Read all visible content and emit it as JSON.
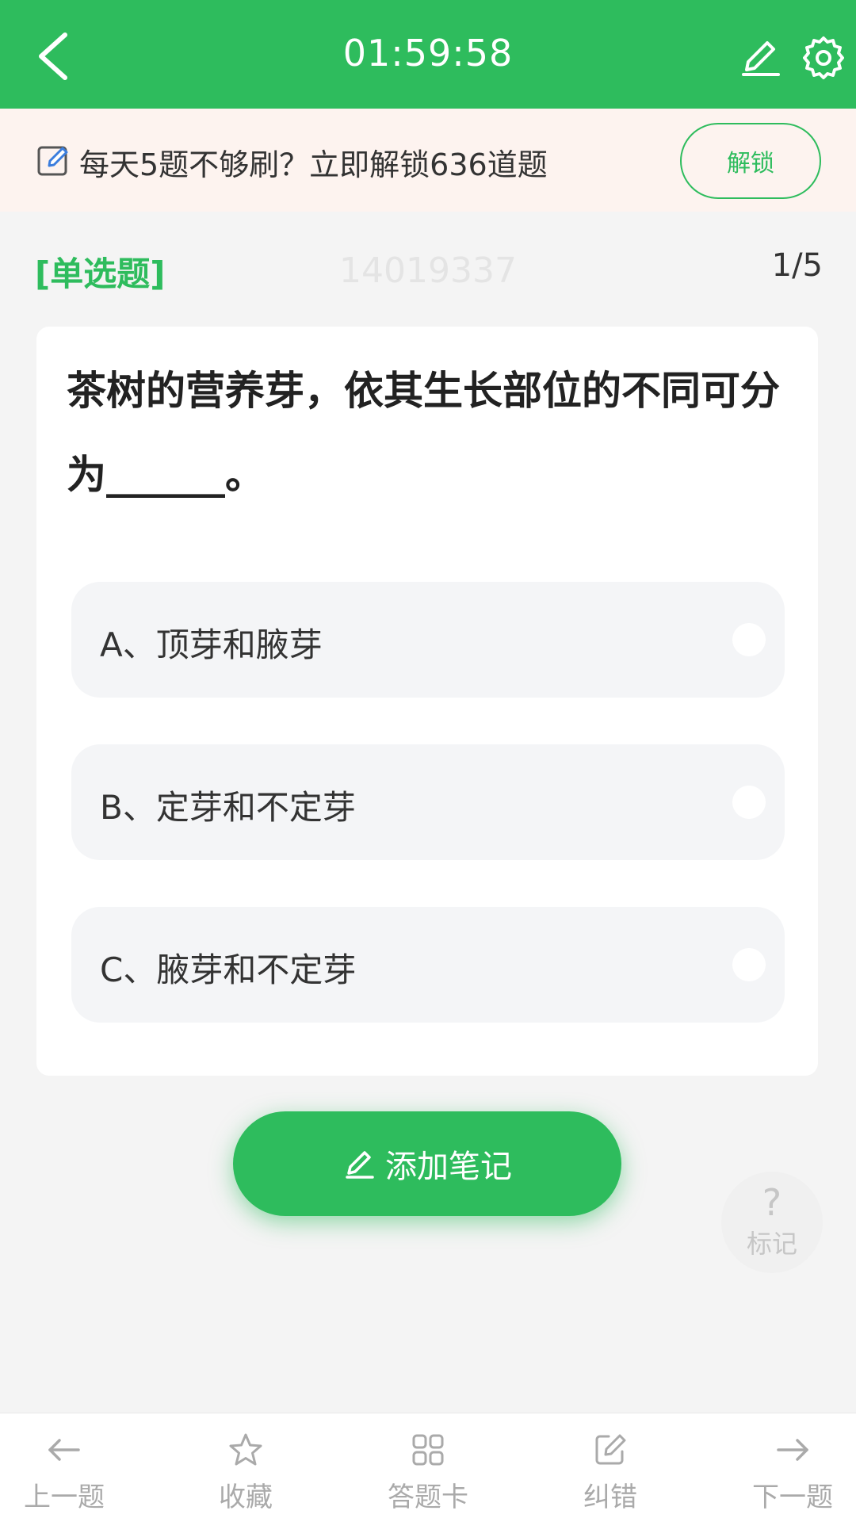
{
  "header": {
    "timer": "01:59:58",
    "icons": [
      "back-arrow-icon",
      "pencil-icon",
      "gear-icon"
    ]
  },
  "banner": {
    "text": "每天5题不够刷？立即解锁636道题",
    "unlock_label": "解锁"
  },
  "question": {
    "type": "[单选题]",
    "id": "14019337",
    "progress": "1/5",
    "text": "茶树的营养芽，依其生长部位的不同可分为______。",
    "options": [
      {
        "label": "A、顶芽和腋芽"
      },
      {
        "label": "B、定芽和不定芽"
      },
      {
        "label": "C、腋芽和不定芽"
      }
    ]
  },
  "actions": {
    "add_note": "添加笔记",
    "mark_symbol": "?",
    "mark_label": "标记"
  },
  "bottom_nav": [
    {
      "label": "上一题",
      "icon": "arrow-left-icon"
    },
    {
      "label": "收藏",
      "icon": "star-icon"
    },
    {
      "label": "答题卡",
      "icon": "grid-icon"
    },
    {
      "label": "纠错",
      "icon": "edit-icon"
    },
    {
      "label": "下一题",
      "icon": "arrow-right-icon"
    }
  ],
  "colors": {
    "primary": "#2ebc5d",
    "banner_bg": "#fdf3ef",
    "page_bg": "#f4f4f4"
  }
}
